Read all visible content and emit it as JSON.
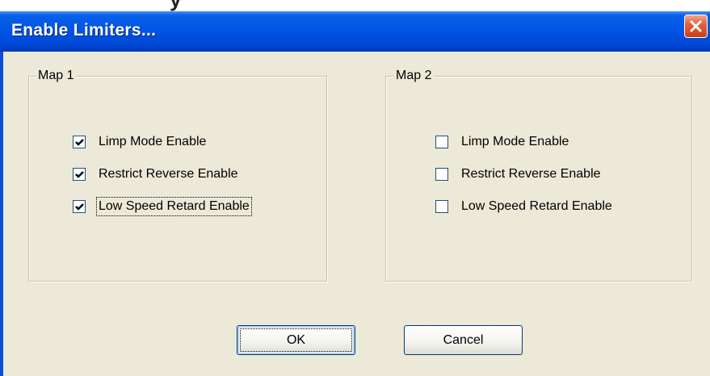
{
  "window": {
    "title": "Enable Limiters...",
    "close_icon": "close-icon"
  },
  "groups": [
    {
      "legend": "Map 1",
      "items": [
        {
          "label": "Limp Mode Enable",
          "checked": true
        },
        {
          "label": "Restrict Reverse Enable",
          "checked": true
        },
        {
          "label": "Low Speed Retard Enable",
          "checked": true,
          "focused": true
        }
      ]
    },
    {
      "legend": "Map 2",
      "items": [
        {
          "label": "Limp Mode Enable",
          "checked": false
        },
        {
          "label": "Restrict Reverse Enable",
          "checked": false
        },
        {
          "label": "Low Speed Retard Enable",
          "checked": false
        }
      ]
    }
  ],
  "buttons": {
    "ok_label": "OK",
    "cancel_label": "Cancel"
  },
  "colors": {
    "titlebar": "#0055e5",
    "dialog_bg": "#ece9d8",
    "close_button": "#e2623c",
    "check_mark": "#21a121"
  }
}
